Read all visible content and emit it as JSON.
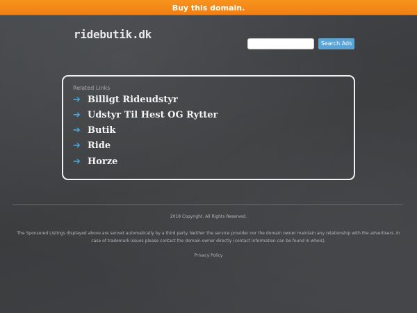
{
  "topbar": {
    "cta_label": "Buy this domain."
  },
  "header": {
    "logo": "ridebutik.dk",
    "search_placeholder": "",
    "search_button_label": "Search Ads"
  },
  "related": {
    "heading": "Related Links",
    "arrow_glyph": "➔",
    "links": [
      {
        "label": "Billigt Rideudstyr"
      },
      {
        "label": "Udstyr Til Hest OG Rytter"
      },
      {
        "label": "Butik"
      },
      {
        "label": "Ride"
      },
      {
        "label": "Horze"
      }
    ]
  },
  "footer": {
    "copyright": "2018 Copyright. All Rights Reserved.",
    "disclaimer": "The Sponsored Listings displayed above are served automatically by a third party. Neither the service provider nor the domain owner maintain any relationship with the advertisers. In case of trademark issues please contact the domain owner directly (contact information can be found in whois).",
    "privacy": "Privacy Policy"
  },
  "colors": {
    "topbar": "#f7941d",
    "background": "#3f4143",
    "link_arrow": "#4aa8dd",
    "search_button": "#5ba4d6"
  }
}
